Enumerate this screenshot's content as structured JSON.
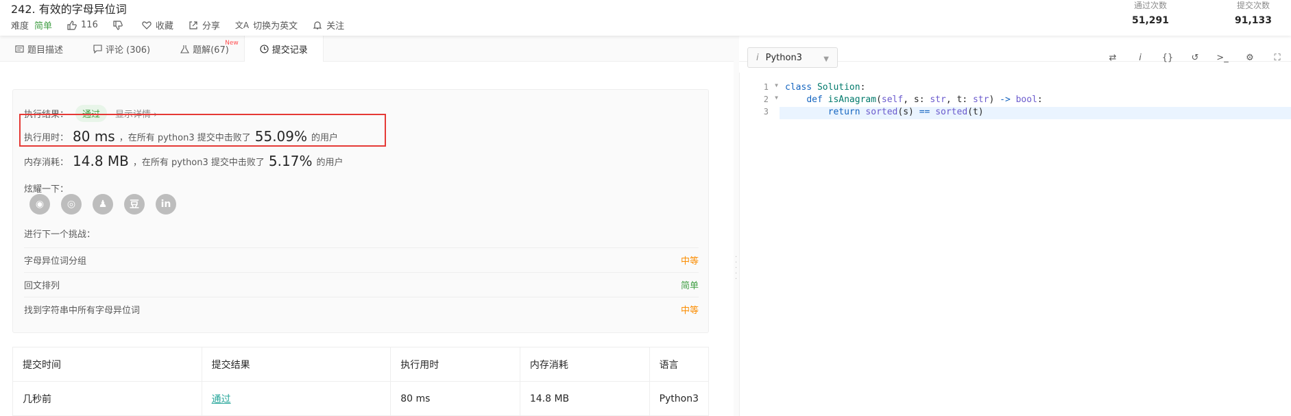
{
  "header": {
    "title": "242. 有效的字母异位词",
    "difficulty_label": "难度",
    "difficulty_value": "简单",
    "likes": "116",
    "collect": "收藏",
    "share": "分享",
    "switch_en": "切换为英文",
    "follow": "关注",
    "stats": [
      {
        "label": "通过次数",
        "value": "51,291"
      },
      {
        "label": "提交次数",
        "value": "91,133"
      }
    ]
  },
  "tabs": [
    {
      "label": "题目描述"
    },
    {
      "label": "评论 (306)"
    },
    {
      "label": "题解(67)",
      "badge": "New"
    },
    {
      "label": "提交记录"
    }
  ],
  "result": {
    "label": "执行结果：",
    "status": "通过",
    "detail_link": "显示详情 ›",
    "runtime_label": "执行用时：",
    "runtime_value": "80 ms",
    "runtime_mid": "，在所有 python3 提交中击败了",
    "runtime_pct": "55.09%",
    "runtime_tail": "的用户",
    "memory_label": "内存消耗：",
    "memory_value": "14.8 MB",
    "memory_mid": "，在所有 python3 提交中击败了",
    "memory_pct": "5.17%",
    "memory_tail": "的用户",
    "share_label": "炫耀一下：",
    "next_label": "进行下一个挑战：",
    "challenges": [
      {
        "name": "字母异位词分组",
        "level": "中等"
      },
      {
        "name": "回文排列",
        "level": "简单"
      },
      {
        "name": "找到字符串中所有字母异位词",
        "level": "中等"
      }
    ]
  },
  "table": {
    "headers": [
      "提交时间",
      "提交结果",
      "执行用时",
      "内存消耗",
      "语言"
    ],
    "rows": [
      {
        "time": "几秒前",
        "result": "通过",
        "runtime": "80 ms",
        "memory": "14.8 MB",
        "lang": "Python3"
      }
    ]
  },
  "editor": {
    "language": "Python3",
    "line_numbers": [
      "1",
      "2",
      "3"
    ]
  },
  "colors": {
    "accent": "#43a047",
    "medium": "#fb8c00",
    "highlight_box": "#e53935"
  }
}
